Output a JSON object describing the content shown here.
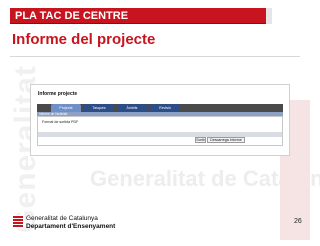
{
  "slide": {
    "header": "PLA TAC DE CENTRE",
    "title": "Informe del projecte",
    "page_number": "26"
  },
  "app": {
    "heading": "Informe projecte",
    "tabs": [
      {
        "label": "Projecte",
        "active": true
      },
      {
        "label": "Tasques",
        "active": false
      },
      {
        "label": "Àmbits",
        "active": false
      },
      {
        "label": "Revisió",
        "active": false
      }
    ],
    "band_text": "Informe de l'activitat",
    "field_label": "Format de sortida PDF",
    "buttons": {
      "exit": "Sortir",
      "download": "Descarrega informe"
    }
  },
  "footer": {
    "line1": "Generalitat de Catalunya",
    "line2": "Departament d'Ensenyament"
  },
  "watermark": {
    "side_text": "Generalitat",
    "line_text": "Generalitat de Catalunya"
  },
  "colors": {
    "brand_red": "#c8141e",
    "tab_blue": "#2c4d86",
    "tab_active": "#6f8fc8"
  }
}
